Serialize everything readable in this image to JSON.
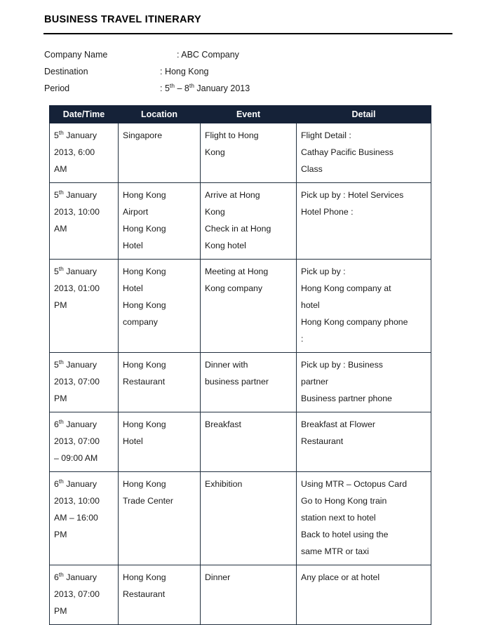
{
  "document": {
    "title": "BUSINESS TRAVEL ITINERARY"
  },
  "info": {
    "rows": [
      {
        "label": "Company Name",
        "value": ": ABC Company",
        "wide": true
      },
      {
        "label": "Destination",
        "value": ": Hong Kong",
        "wide": false
      },
      {
        "label": "Period",
        "value": ": 5th – 8th January 2013",
        "wide": false
      }
    ],
    "period_prefix": ": 5",
    "period_sup1": "th",
    "period_mid": " – 8",
    "period_sup2": "th",
    "period_suffix": " January 2013"
  },
  "table": {
    "headers": [
      "Date/Time",
      "Location",
      "Event",
      "Detail"
    ],
    "header_bg": "#152238",
    "header_color": "#ffffff",
    "border_color": "#22303f",
    "rows": [
      {
        "datetime": [
          "5th January",
          "2013, 6:00",
          "AM"
        ],
        "location": [
          "Singapore"
        ],
        "event": [
          "Flight to Hong",
          "Kong"
        ],
        "detail": [
          "Flight Detail :",
          "Cathay Pacific Business",
          "Class"
        ]
      },
      {
        "datetime": [
          "5th January",
          "2013, 10:00",
          "AM"
        ],
        "location": [
          "Hong Kong",
          "Airport",
          "Hong Kong",
          "Hotel"
        ],
        "event": [
          "Arrive at Hong",
          "Kong",
          "Check in at Hong",
          "Kong hotel"
        ],
        "detail": [
          "Pick up by : Hotel Services",
          "Hotel Phone :"
        ]
      },
      {
        "datetime": [
          "5th January",
          "2013, 01:00",
          "PM"
        ],
        "location": [
          "Hong Kong",
          "Hotel",
          "Hong Kong",
          "company"
        ],
        "event": [
          "Meeting at Hong",
          "Kong company"
        ],
        "detail": [
          "Pick up by :",
          "Hong Kong company at",
          "hotel",
          "Hong Kong company phone",
          ":"
        ]
      },
      {
        "datetime": [
          "5th January",
          "2013, 07:00",
          "PM"
        ],
        "location": [
          "Hong Kong",
          "Restaurant"
        ],
        "event": [
          "Dinner with",
          "business partner"
        ],
        "detail": [
          "Pick up by : Business",
          "partner",
          "Business partner phone"
        ]
      },
      {
        "datetime": [
          "6th January",
          "2013, 07:00",
          "– 09:00 AM"
        ],
        "location": [
          "Hong Kong",
          "Hotel"
        ],
        "event": [
          "Breakfast"
        ],
        "detail": [
          "Breakfast at Flower",
          "Restaurant"
        ]
      },
      {
        "datetime": [
          "6th January",
          "2013, 10:00",
          "AM – 16:00",
          "PM"
        ],
        "location": [
          "Hong Kong",
          "Trade Center"
        ],
        "event": [
          "Exhibition"
        ],
        "detail": [
          "Using MTR – Octopus Card",
          "Go to Hong Kong train",
          "station next to hotel",
          "Back to hotel using the",
          "same MTR or taxi"
        ]
      },
      {
        "datetime": [
          "6th January",
          "2013, 07:00",
          "PM"
        ],
        "location": [
          "Hong Kong",
          "Restaurant"
        ],
        "event": [
          "Dinner"
        ],
        "detail": [
          "Any place or at hotel"
        ]
      }
    ]
  }
}
